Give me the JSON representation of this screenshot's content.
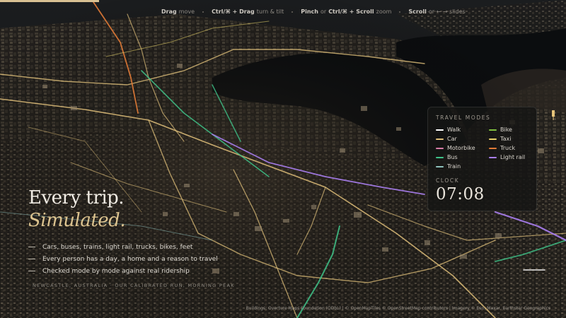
{
  "hints": [
    {
      "key": "Drag",
      "text": "move"
    },
    {
      "key": "Ctrl/⌘ + Drag",
      "text": "turn & tilt"
    },
    {
      "key": "Pinch",
      "mid": "or",
      "key2": "Ctrl/⌘ + Scroll",
      "text": "zoom"
    },
    {
      "key": "Scroll",
      "text": "or ← → slides"
    }
  ],
  "panel": {
    "modes_title": "TRAVEL MODES",
    "modes": [
      {
        "label": "Walk",
        "color": "#ffffff"
      },
      {
        "label": "Bike",
        "color": "#7fbf3f"
      },
      {
        "label": "Car",
        "color": "#e0c07a"
      },
      {
        "label": "Taxi",
        "color": "#e8d36a"
      },
      {
        "label": "Motorbike",
        "color": "#d77ca8"
      },
      {
        "label": "Truck",
        "color": "#e07a36"
      },
      {
        "label": "Bus",
        "color": "#3fc48a"
      },
      {
        "label": "Light rail",
        "color": "#a97ef0"
      },
      {
        "label": "Train",
        "color": "#8fc2bd"
      }
    ],
    "clock_title": "CLOCK",
    "clock_value": "07:08"
  },
  "hero": {
    "line1": "Every trip.",
    "line2": "Simulated.",
    "bullets": [
      "Cars, buses, trains, light rail, trucks, bikes, feet",
      "Every person has a day, a home and a reason to travel",
      "Checked mode by mode against real ridership"
    ],
    "location": "NEWCASTLE, AUSTRALIA · OUR CALIBRATED RUN, MORNING PEAK"
  },
  "attribution": "Buildings: Overture Maps Foundation (ODbL) | © OpenMapTiles © OpenStreetMap contributors | Imagery © Esri, Maxar, Earthstar Geographics",
  "colors": {
    "accent": "#dcc38f",
    "road_car": "#e0c07a",
    "road_bus": "#3fc48a",
    "road_light_rail": "#a97ef0",
    "road_truck": "#e07a36"
  }
}
